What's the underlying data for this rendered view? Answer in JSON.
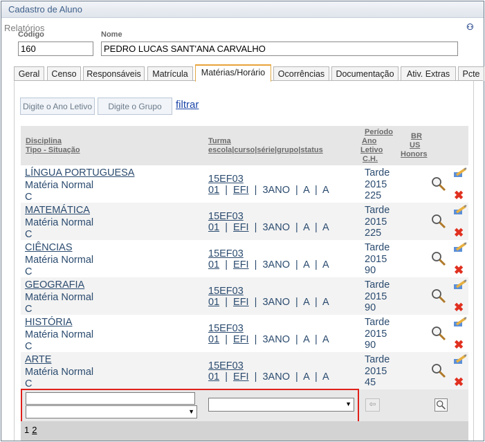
{
  "window": {
    "title": "Cadastro de Aluno"
  },
  "header": {
    "relatorios_label": "Relatórios",
    "codigo_label": "Código",
    "nome_label": "Nome",
    "codigo_value": "160",
    "nome_value": "PEDRO LUCAS SANT'ANA CARVALHO"
  },
  "tabs": [
    {
      "label": "Geral"
    },
    {
      "label": "Censo"
    },
    {
      "label": "Responsáveis"
    },
    {
      "label": "Matrícula"
    },
    {
      "label": "Matérias/Horário",
      "active": true
    },
    {
      "label": "Ocorrências"
    },
    {
      "label": "Documentação"
    },
    {
      "label": "Ativ. Extras"
    },
    {
      "label": "Pcte"
    }
  ],
  "filters": {
    "ano_placeholder": "Digite o Ano Letivo",
    "grupo_placeholder": "Digite o Grupo",
    "filtrar_label": "filtrar"
  },
  "table": {
    "headers": {
      "disciplina": "Disciplina",
      "tipo_situacao": "Tipo - Situação",
      "turma": "Turma",
      "turma_sub": "escola|curso|série|grupo|status",
      "periodo": "Período",
      "ano_letivo_1": "Ano",
      "ano_letivo_2": "Letivo",
      "ch": "C.H.",
      "br": "BR",
      "us": "US",
      "honors": "Honors"
    },
    "rows": [
      {
        "disciplina": "LÍNGUA PORTUGUESA",
        "tipo": "Matéria Normal",
        "situacao": "C",
        "turma": "15EF03",
        "escola": "01",
        "curso": "EFI",
        "serie": "3ANO",
        "grupo": "A",
        "status": "A",
        "periodo": "Tarde",
        "ano": "2015",
        "ch": "225"
      },
      {
        "disciplina": "MATEMÁTICA",
        "tipo": "Matéria Normal",
        "situacao": "C",
        "turma": "15EF03",
        "escola": "01",
        "curso": "EFI",
        "serie": "3ANO",
        "grupo": "A",
        "status": "A",
        "periodo": "Tarde",
        "ano": "2015",
        "ch": "225"
      },
      {
        "disciplina": "CIÊNCIAS",
        "tipo": "Matéria Normal",
        "situacao": "C",
        "turma": "15EF03",
        "escola": "01",
        "curso": "EFI",
        "serie": "3ANO",
        "grupo": "A",
        "status": "A",
        "periodo": "Tarde",
        "ano": "2015",
        "ch": "90"
      },
      {
        "disciplina": "GEOGRAFIA",
        "tipo": "Matéria Normal",
        "situacao": "C",
        "turma": "15EF03",
        "escola": "01",
        "curso": "EFI",
        "serie": "3ANO",
        "grupo": "A",
        "status": "A",
        "periodo": "Tarde",
        "ano": "2015",
        "ch": "90"
      },
      {
        "disciplina": "HISTÓRIA",
        "tipo": "Matéria Normal",
        "situacao": "C",
        "turma": "15EF03",
        "escola": "01",
        "curso": "EFI",
        "serie": "3ANO",
        "grupo": "A",
        "status": "A",
        "periodo": "Tarde",
        "ano": "2015",
        "ch": "90"
      },
      {
        "disciplina": "ARTE",
        "tipo": "Matéria Normal",
        "situacao": "C",
        "turma": "15EF03",
        "escola": "01",
        "curso": "EFI",
        "serie": "3ANO",
        "grupo": "A",
        "status": "A",
        "periodo": "Tarde",
        "ano": "2015",
        "ch": "45"
      }
    ]
  },
  "pagination": {
    "current": "1",
    "next": "2"
  },
  "colors": {
    "accent_tab": "#e8a33a",
    "highlight_box": "#e0201a",
    "link": "#1a45a8",
    "delete": "#e03020"
  },
  "icons": {
    "view": "magnifier-icon",
    "edit": "pencil-icon",
    "delete": "delete-icon",
    "search": "binoculars-icon"
  }
}
